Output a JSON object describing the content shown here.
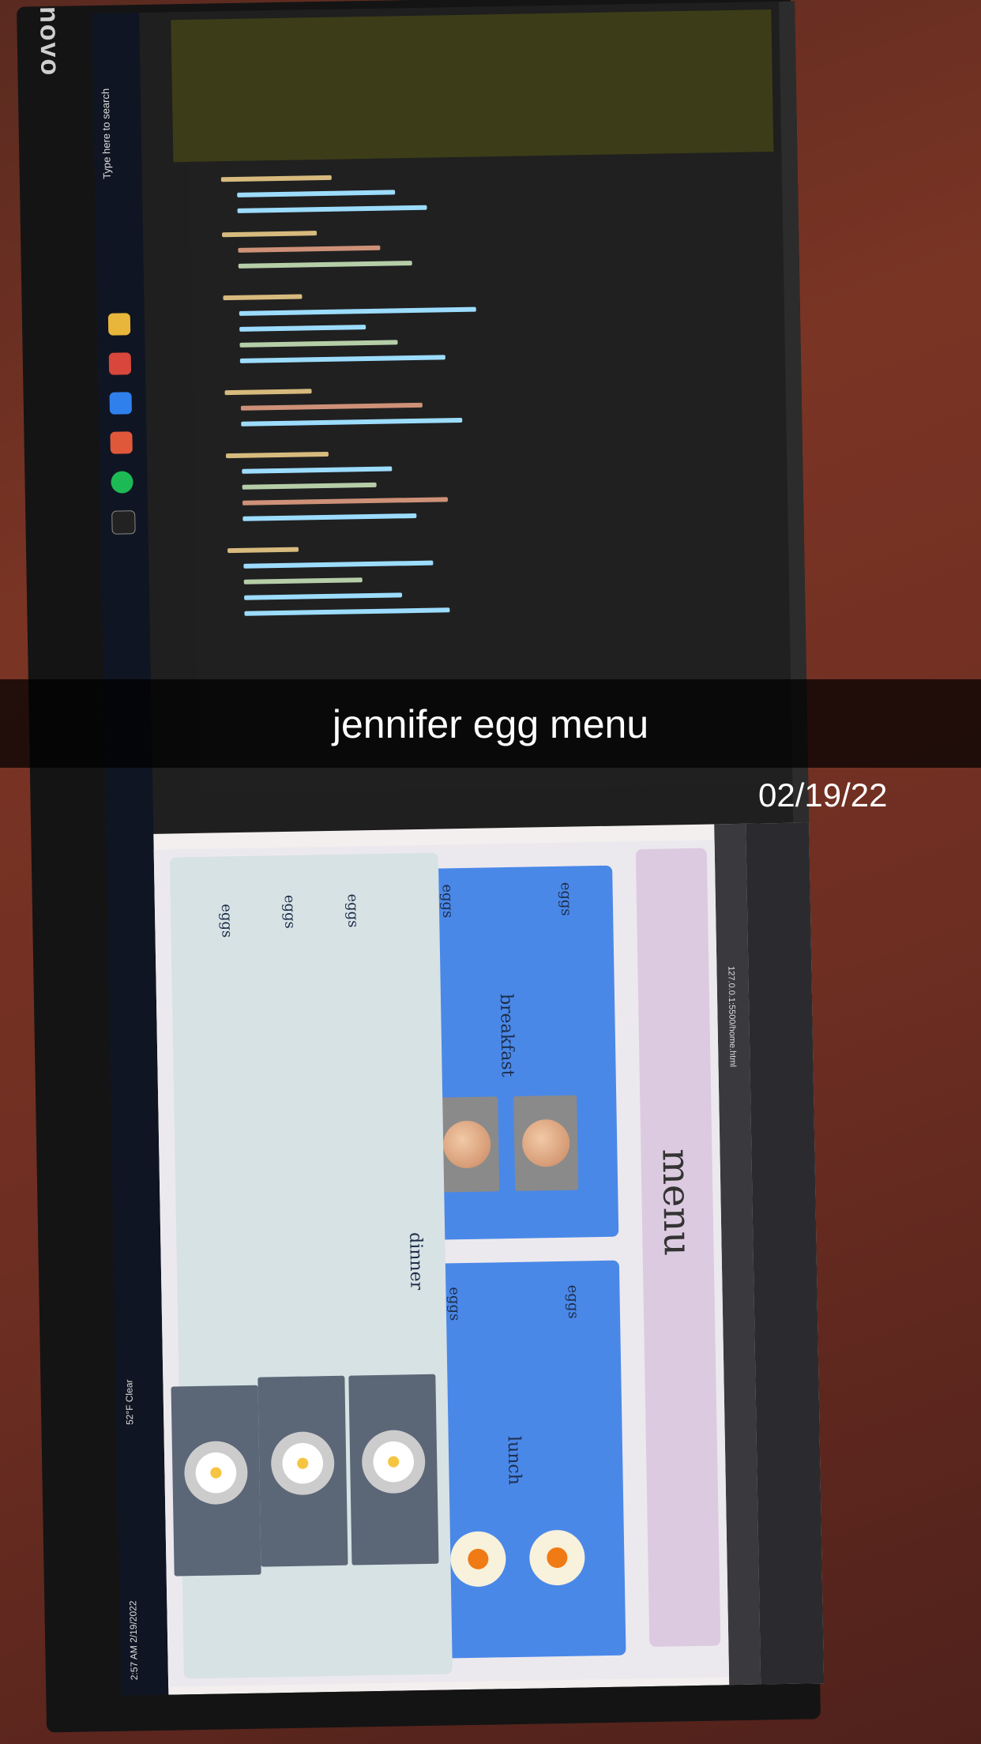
{
  "caption": "jennifer egg menu",
  "date": "02/19/22",
  "monitor": {
    "brand": "novo"
  },
  "taskbar": {
    "search_placeholder": "Type here to search",
    "weather": "52°F Clear",
    "time": "2:57 AM",
    "date": "2/19/2022"
  },
  "browser": {
    "url": "127.0.0.1:5500/home.html"
  },
  "page": {
    "title": "menu",
    "breakfast": {
      "title": "breakfast",
      "items": [
        "eggs",
        "eggs"
      ]
    },
    "lunch": {
      "title": "lunch",
      "items": [
        "eggs",
        "eggs"
      ]
    },
    "dinner": {
      "title": "dinner",
      "items": [
        "eggs",
        "eggs",
        "eggs"
      ]
    }
  }
}
